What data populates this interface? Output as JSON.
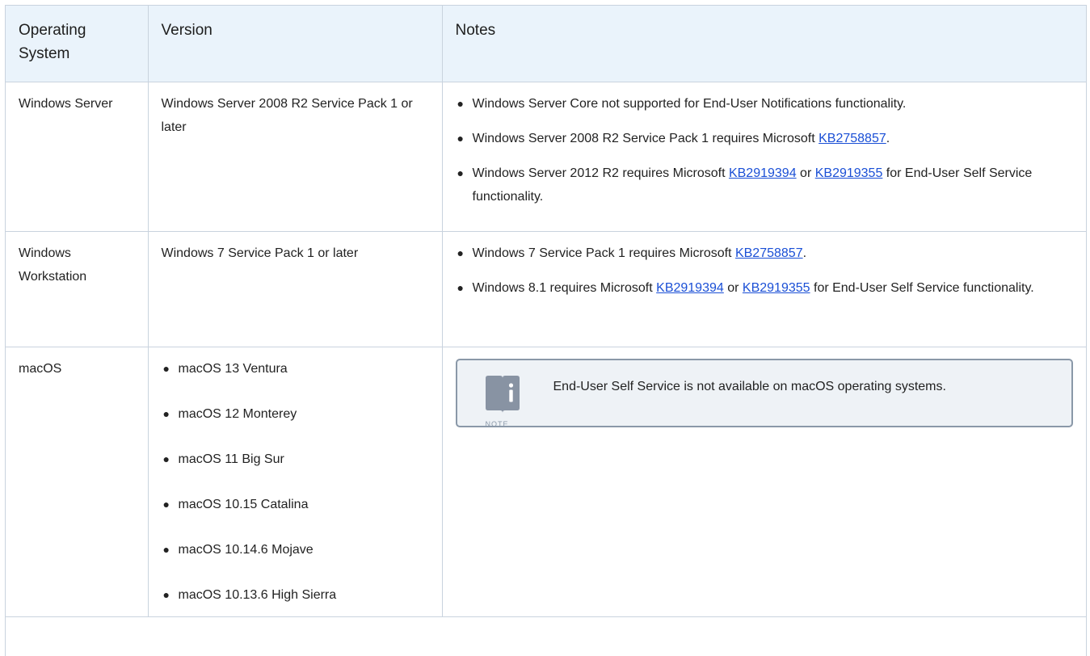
{
  "header": {
    "col1": "Operating System",
    "col2": "Version",
    "col3": "Notes"
  },
  "rows": [
    {
      "os": "Windows Server",
      "version": "Windows Server 2008 R2 Service Pack 1 or later",
      "notes": {
        "n0": {
          "text": "Windows Server Core not supported for End-User Notifications functionality."
        },
        "n1": {
          "pre": "Windows Server 2008 R2 Service Pack 1 requires Microsoft ",
          "link": "KB2758857",
          "post": "."
        },
        "n2": {
          "pre": "Windows Server 2012 R2 requires Microsoft ",
          "link1": "KB2919394",
          "mid": " or ",
          "link2": "KB2919355",
          "post": " for End-User Self Service functionality."
        }
      }
    },
    {
      "os": "Windows Workstation",
      "version": "Windows 7 Service Pack 1 or later",
      "notes": {
        "n0": {
          "pre": "Windows 7 Service Pack 1 requires Microsoft ",
          "link": "KB2758857",
          "post": "."
        },
        "n1": {
          "pre": "Windows 8.1 requires Microsoft ",
          "link1": "KB2919394",
          "mid": " or ",
          "link2": "KB2919355",
          "post": " for End-User Self Service functionality."
        }
      }
    },
    {
      "os": "macOS",
      "versions": [
        "macOS 13 Ventura",
        "macOS 12 Monterey",
        "macOS 11 Big Sur",
        "macOS 10.15 Catalina",
        "macOS 10.14.6 Mojave",
        "macOS 10.13.6 High Sierra"
      ],
      "note": {
        "icon": "note-book-icon",
        "caption": "NOTE",
        "text": "End-User Self Service is not available on macOS operating systems."
      }
    }
  ],
  "colors": {
    "header_bg": "#eaf3fb",
    "border": "#c9d3de",
    "link": "#1a4fd6",
    "note_bg": "#eef2f6",
    "note_border": "#8a98a8"
  }
}
